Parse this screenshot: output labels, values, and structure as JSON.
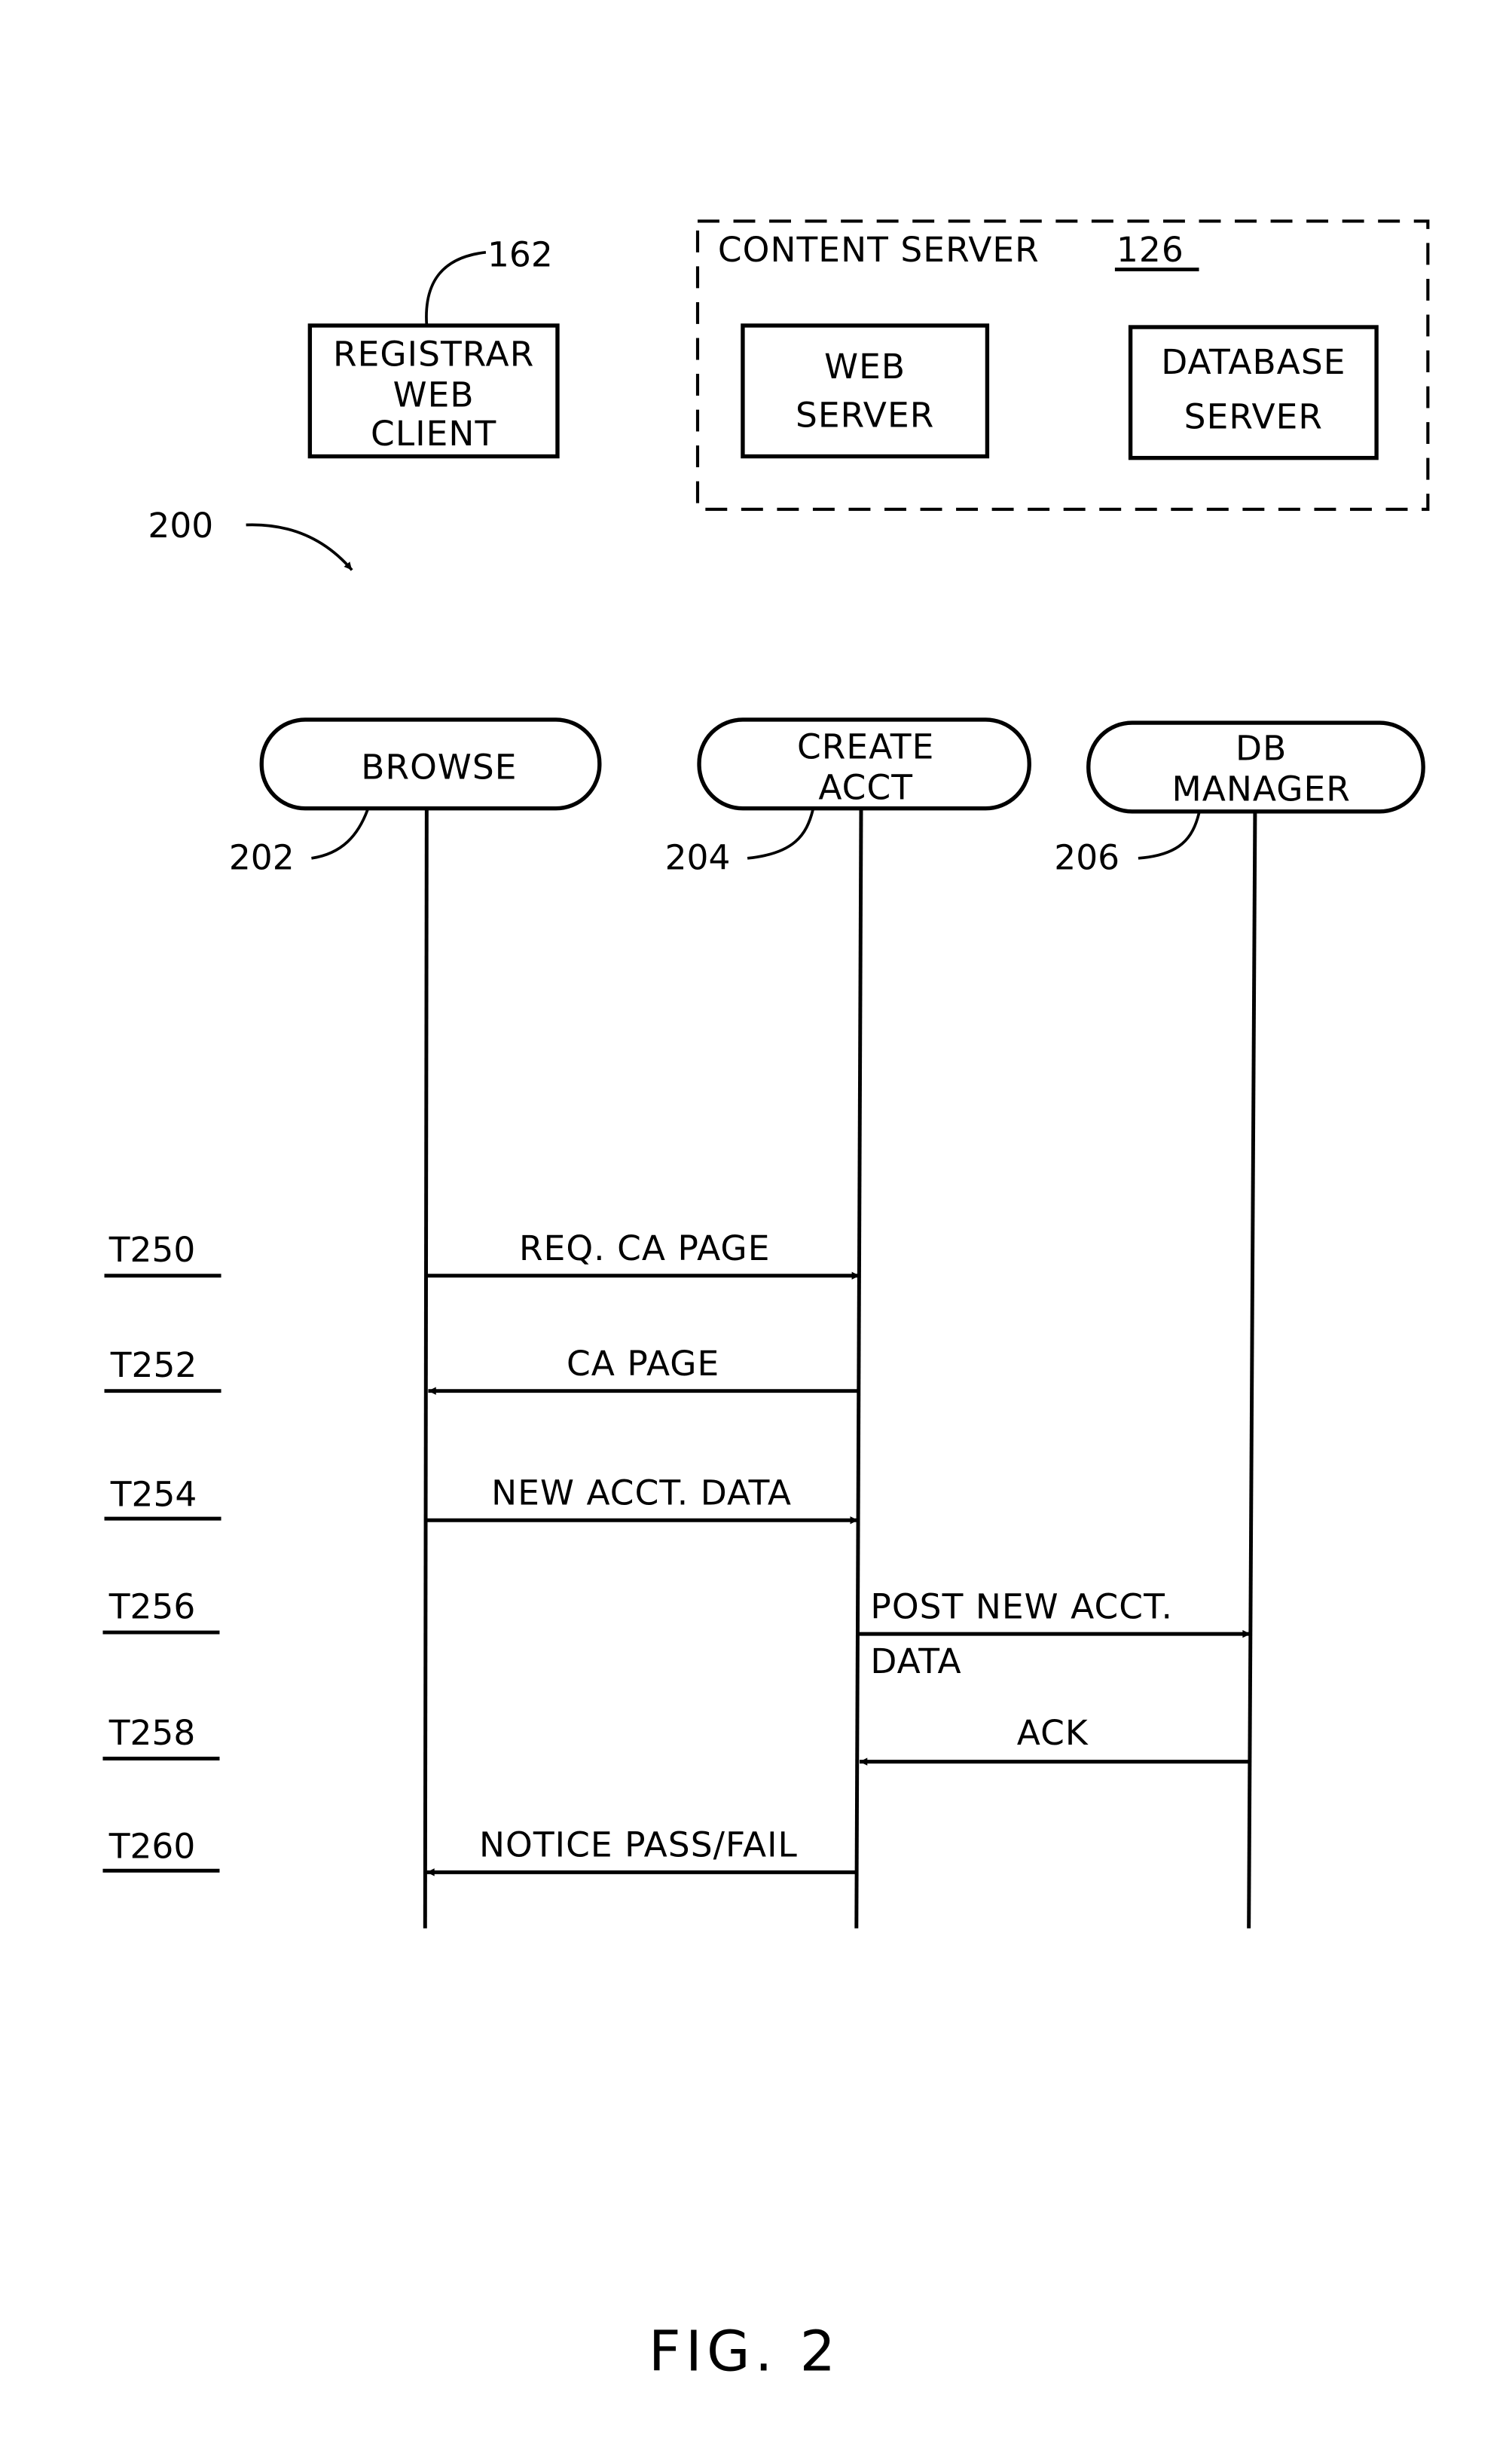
{
  "figure": {
    "caption": "FIG. 2",
    "diagram_ref": "200"
  },
  "components": {
    "registrar_client": {
      "lines": [
        "REGISTRAR",
        "WEB",
        "CLIENT"
      ],
      "ref": "162"
    },
    "content_server": {
      "title": "CONTENT SERVER",
      "ref": "126",
      "web_server": {
        "lines": [
          "WEB",
          "SERVER"
        ]
      },
      "database_server": {
        "lines": [
          "DATABASE",
          "SERVER"
        ]
      }
    }
  },
  "lifelines": [
    {
      "id": "browse",
      "lines": [
        "BROWSE"
      ],
      "ref": "202"
    },
    {
      "id": "create_acct",
      "lines": [
        "CREATE",
        "ACCT"
      ],
      "ref": "204"
    },
    {
      "id": "db_manager",
      "lines": [
        "DB",
        "MANAGER"
      ],
      "ref": "206"
    }
  ],
  "messages": [
    {
      "time": "T250",
      "label": [
        "REQ. CA PAGE"
      ],
      "from": "browse",
      "to": "create_acct"
    },
    {
      "time": "T252",
      "label": [
        "CA PAGE"
      ],
      "from": "create_acct",
      "to": "browse"
    },
    {
      "time": "T254",
      "label": [
        "NEW ACCT. DATA"
      ],
      "from": "browse",
      "to": "create_acct"
    },
    {
      "time": "T256",
      "label": [
        "POST NEW ACCT.",
        "DATA"
      ],
      "from": "create_acct",
      "to": "db_manager"
    },
    {
      "time": "T258",
      "label": [
        "ACK"
      ],
      "from": "db_manager",
      "to": "create_acct"
    },
    {
      "time": "T260",
      "label": [
        "NOTICE PASS/FAIL"
      ],
      "from": "create_acct",
      "to": "browse"
    }
  ]
}
